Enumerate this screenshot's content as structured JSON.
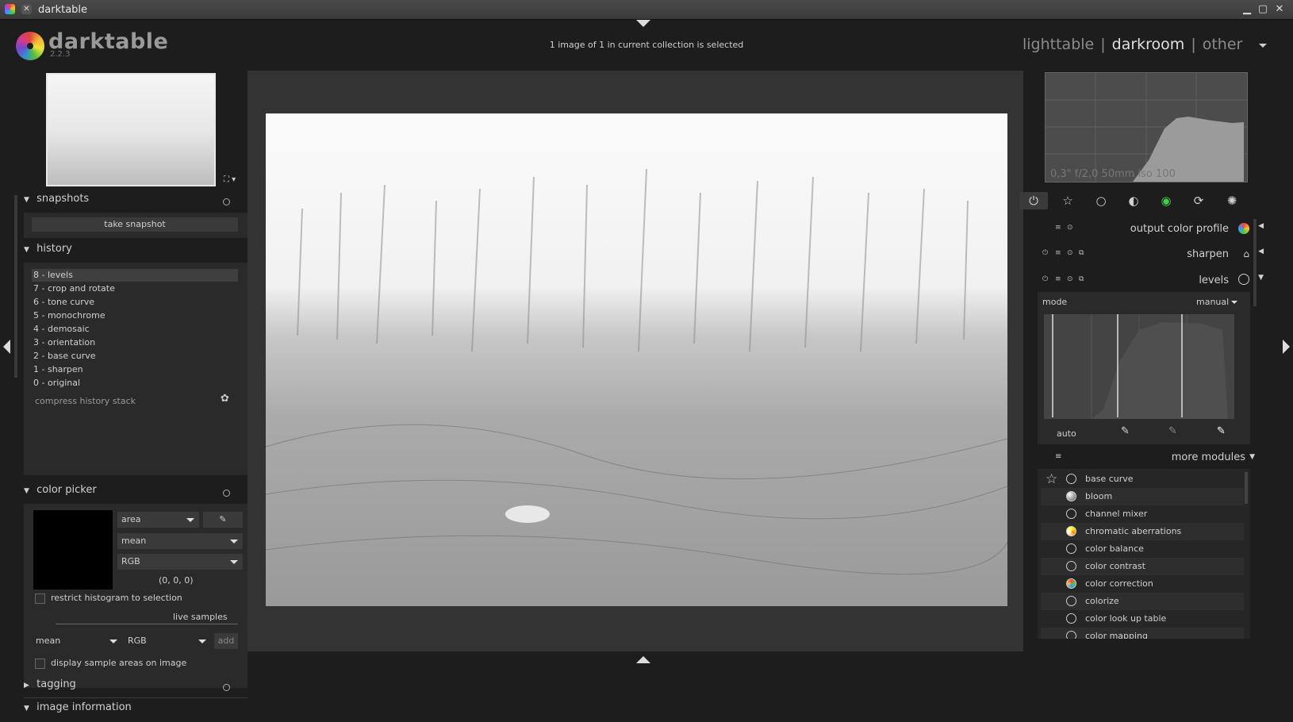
{
  "window": {
    "title": "darktable"
  },
  "app": {
    "name": "darktable",
    "version": "2.2.3"
  },
  "header": {
    "selection_msg": "1 image of 1 in current collection is selected"
  },
  "views": {
    "items": [
      "lighttable",
      "darkroom",
      "other"
    ],
    "active": "darkroom",
    "separator": "|"
  },
  "left": {
    "snapshots": {
      "title": "snapshots",
      "take_label": "take snapshot"
    },
    "history": {
      "title": "history",
      "items": [
        "8 - levels",
        "7 - crop and rotate",
        "6 - tone curve",
        "5 - monochrome",
        "4 - demosaic",
        "3 - orientation",
        "2 - base curve",
        "1 - sharpen",
        "0 - original"
      ],
      "compress_label": "compress history stack"
    },
    "color_picker": {
      "title": "color picker",
      "area_value": "area",
      "mean_value": "mean",
      "rgb_value": "RGB",
      "readout": "(0, 0, 0)",
      "restrict_label": "restrict histogram to selection",
      "live_samples_label": "live samples",
      "sample_mode": "mean",
      "sample_space": "RGB",
      "add_label": "add",
      "display_areas_label": "display sample areas on image"
    },
    "tagging": {
      "title": "tagging"
    },
    "image_info": {
      "title": "image information"
    }
  },
  "right": {
    "histogram_info": "0,3\" f/2,0 50mm iso 100",
    "modules": [
      {
        "name": "output color profile"
      },
      {
        "name": "sharpen"
      },
      {
        "name": "levels"
      }
    ],
    "levels": {
      "mode_label": "mode",
      "mode_value": "manual",
      "auto_label": "auto"
    },
    "more_modules_label": "more modules",
    "more_list": [
      "base curve",
      "bloom",
      "channel mixer",
      "chromatic aberrations",
      "color balance",
      "color contrast",
      "color correction",
      "colorize",
      "color look up table",
      "color mapping"
    ]
  },
  "icons": [
    "power-icon",
    "star-icon",
    "circle-icon",
    "half-circle-icon",
    "color-icon",
    "rotate-icon",
    "aperture-icon"
  ]
}
